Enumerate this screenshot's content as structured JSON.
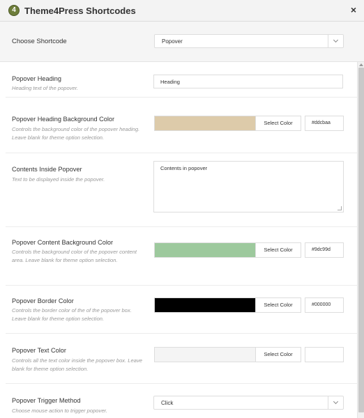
{
  "window": {
    "title": "Theme4Press Shortcodes",
    "logo_glyph": "4",
    "close_glyph": "×"
  },
  "chooser": {
    "label": "Choose Shortcode",
    "selected": "Popover"
  },
  "fields": {
    "heading": {
      "label": "Popover Heading",
      "desc": "Heading text of the popover.",
      "value": "Heading"
    },
    "heading_bg": {
      "label": "Popover Heading Background Color",
      "desc": "Controls the background color of the popover heading. Leave blank for theme option selection.",
      "button": "Select Color",
      "hex": "#ddcbaa",
      "color": "#ddcbaa"
    },
    "contents": {
      "label": "Contents Inside Popover",
      "desc": "Text to be displayed inside the popover.",
      "value": "Contents in popover"
    },
    "content_bg": {
      "label": "Popover Content Background Color",
      "desc": "Controls the background color of the popover content area. Leave blank for theme option selection.",
      "button": "Select Color",
      "hex": "#9dc99d",
      "color": "#9dc99d"
    },
    "border": {
      "label": "Popover Border Color",
      "desc": "Controls the border color of the of the popover box. Leave blank for theme option selection.",
      "button": "Select Color",
      "hex": "#000000",
      "color": "#000000"
    },
    "text_color": {
      "label": "Popover Text Color",
      "desc": "Controls all the text color inside the popover box. Leave blank for theme option selection.",
      "button": "Select Color",
      "hex": "",
      "color": "#f4f4f4"
    },
    "trigger": {
      "label": "Popover Trigger Method",
      "desc": "Choose mouse action to trigger popover.",
      "selected": "Click"
    }
  }
}
